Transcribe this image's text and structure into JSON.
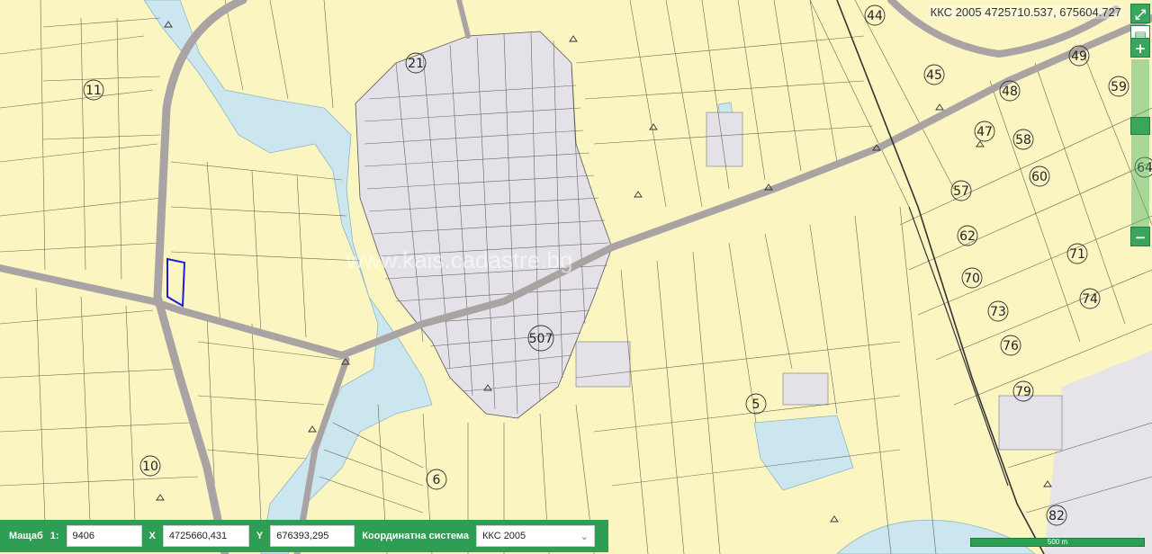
{
  "coordinate_readout": "ККС 2005 4725710.537, 675604.727",
  "zoom": {
    "fullscreen_icon": "expand-icon",
    "layers_icon": "layers-icon",
    "zoom_in_label": "+",
    "zoom_out_label": "−"
  },
  "parcel_labels": [
    "44",
    "21",
    "11",
    "45",
    "49",
    "59",
    "48",
    "47",
    "58",
    "60",
    "57",
    "62",
    "71",
    "70",
    "74",
    "73",
    "76",
    "79",
    "507",
    "5",
    "10",
    "6",
    "82",
    "64"
  ],
  "watermark": "www.kais.cadastre.bg",
  "bottom_bar": {
    "scale_label": "Мащаб",
    "scale_prefix": "1:",
    "scale_value": "9406",
    "x_label": "X",
    "x_value": "4725660,431",
    "y_label": "Y",
    "y_value": "676393,295",
    "crs_label": "Координатна система",
    "crs_value": "ККС 2005",
    "crs_icon": "chevron-down-icon"
  },
  "scale_bar_text": "500 m",
  "colors": {
    "parcel_fill": "#fbf5c2",
    "water": "#cbe6ee",
    "road": "#a9a3a3",
    "urban_block": "#e4e2e8",
    "ui_green": "#2e9e55",
    "selected_parcel": "#1d1de0"
  }
}
